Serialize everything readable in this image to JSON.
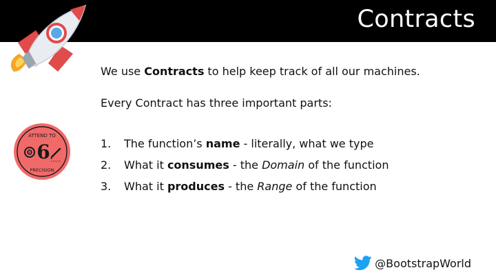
{
  "header": {
    "title": "Contracts"
  },
  "intro": {
    "lead": "We use ",
    "term": "Contracts",
    "rest": " to help keep track of all our machines."
  },
  "subheading": "Every Contract has three important parts:",
  "parts": [
    {
      "num": "1.",
      "pre": "The function’s ",
      "bold": "name",
      "mid": " - literally, what we type",
      "italic": "",
      "post": ""
    },
    {
      "num": "2.",
      "pre": "What it ",
      "bold": "consumes",
      "mid": " - the ",
      "italic": "Domain",
      "post": " of the function"
    },
    {
      "num": "3.",
      "pre": "What it ",
      "bold": "produces",
      "mid": " - the ",
      "italic": "Range",
      "post": " of the function"
    }
  ],
  "badge": {
    "top_text": "ATTEND TO",
    "number": "6",
    "bottom_text": "PRECISION",
    "color": "#f06a6a"
  },
  "footer": {
    "handle": "@BootstrapWorld",
    "icon": "twitter-bird-icon",
    "icon_color": "#1da1f2"
  },
  "colors": {
    "header_bg": "#000000",
    "rocket_body": "#e9edf2",
    "rocket_red": "#e14b4b",
    "flame": "#f5a623"
  }
}
